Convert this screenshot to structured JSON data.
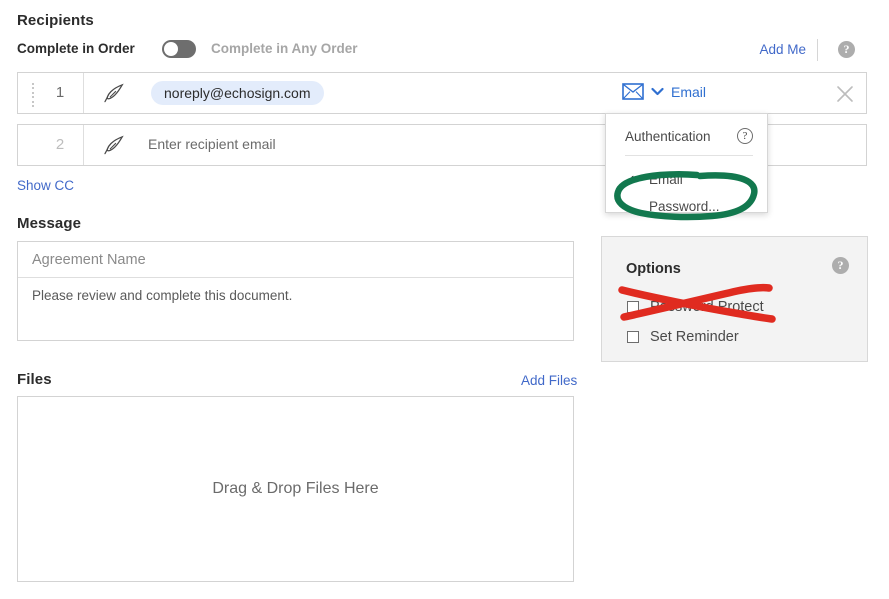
{
  "recipients": {
    "title": "Recipients",
    "complete_in_order_label": "Complete in Order",
    "complete_in_any_order_label": "Complete in Any Order",
    "toggle_state": "off",
    "add_me_label": "Add Me",
    "help_icon_glyph": "?",
    "rows": [
      {
        "index": "1",
        "email": "noreply@echosign.com",
        "auth_label": "Email",
        "auth_icon": "envelope-icon",
        "chevron_glyph": "⌄",
        "close_glyph": "×"
      },
      {
        "index": "2",
        "placeholder": "Enter recipient email"
      }
    ],
    "show_cc_label": "Show CC"
  },
  "auth_menu": {
    "header_label": "Authentication",
    "help_icon_glyph": "?",
    "items": [
      {
        "label": "Email",
        "checked": true,
        "check_glyph": "✓"
      },
      {
        "label": "Password...",
        "checked": false,
        "check_glyph": ""
      }
    ]
  },
  "message": {
    "title": "Message",
    "agreement_name_placeholder": "Agreement Name",
    "agreement_name_value": "",
    "body_value": "Please review and complete this document."
  },
  "files": {
    "title": "Files",
    "add_files_label": "Add Files",
    "dropzone_label": "Drag & Drop Files Here"
  },
  "options": {
    "title": "Options",
    "help_icon_glyph": "?",
    "items": [
      {
        "label": "Password Protect",
        "checked": false
      },
      {
        "label": "Set Reminder",
        "checked": false
      }
    ]
  },
  "annotations": [
    {
      "name": "green-ellipse-password-menu-item",
      "color": "#12784e",
      "shape": "ellipse"
    },
    {
      "name": "red-cross-password-protect-option",
      "color": "#e02b20",
      "shape": "cross"
    }
  ],
  "colors": {
    "link_blue": "#4169c9",
    "auth_blue": "#2f6fd0",
    "chip_background": "#e3ecfb",
    "panel_background": "#f3f3f3",
    "annotation_green": "#12784e",
    "annotation_red": "#e02b20"
  }
}
